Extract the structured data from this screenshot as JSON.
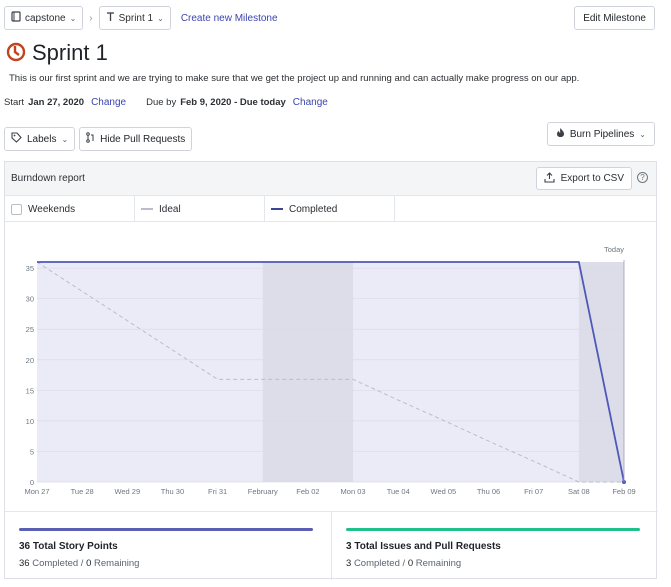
{
  "breadcrumb": {
    "repo": "capstone",
    "milestone": "Sprint 1",
    "create_link": "Create new Milestone"
  },
  "edit_button": "Edit Milestone",
  "milestone": {
    "title": "Sprint 1",
    "description": "This is our first sprint and we are trying to make sure that we get the project up and running and can actually make progress on our app.",
    "start_label": "Start",
    "start_date": "Jan 27, 2020",
    "start_change": "Change",
    "due_label": "Due by",
    "due_date": "Feb 9, 2020 - Due today",
    "due_change": "Change"
  },
  "filters": {
    "labels_button": "Labels",
    "hide_prs_button": "Hide Pull Requests",
    "burn_button": "Burn Pipelines"
  },
  "report": {
    "title": "Burndown report",
    "export_button": "Export to CSV",
    "help": "?",
    "legend": {
      "weekends": "Weekends",
      "ideal": "Ideal",
      "completed": "Completed"
    }
  },
  "colors": {
    "accent": "#4e58b8",
    "milestone_icon": "#c0451f",
    "ideal_line": "#b9bdcc",
    "completed_line": "#4e58b8",
    "weekend_band": "#dcdde8",
    "area_fill": "#ebebf7",
    "story_bar": "#5b5fb3",
    "issues_bar": "#1fc08a"
  },
  "chart_data": {
    "type": "line",
    "title": "",
    "xlabel": "",
    "ylabel": "",
    "ylim": [
      0,
      36
    ],
    "yticks": [
      0,
      5,
      10,
      15,
      20,
      25,
      30,
      35
    ],
    "categories": [
      "Mon 27",
      "Tue 28",
      "Wed 29",
      "Thu 30",
      "Fri 31",
      "February",
      "Feb 02",
      "Mon 03",
      "Tue 04",
      "Wed 05",
      "Thu 06",
      "Fri 07",
      "Sat 08",
      "Feb 09"
    ],
    "weekend_ranges": [
      [
        "February",
        "Mon 03"
      ],
      [
        "Sat 08",
        "Feb 09"
      ]
    ],
    "today_label": "Today",
    "today_index": 13,
    "grid": true,
    "series": [
      {
        "name": "Ideal",
        "style": "dashed",
        "values": [
          36,
          31.2,
          26.4,
          21.6,
          16.8,
          16.8,
          16.8,
          16.8,
          13.4,
          10.1,
          6.7,
          3.4,
          0,
          0
        ]
      },
      {
        "name": "Completed",
        "style": "solid",
        "values": [
          36,
          36,
          36,
          36,
          36,
          36,
          36,
          36,
          36,
          36,
          36,
          36,
          36,
          0
        ]
      }
    ]
  },
  "stats": {
    "story_points": {
      "title": "36 Total Story Points",
      "completed": "36",
      "completed_label": "Completed /",
      "remaining": "0",
      "remaining_label": "Remaining"
    },
    "issues": {
      "title": "3 Total Issues and Pull Requests",
      "completed": "3",
      "completed_label": "Completed /",
      "remaining": "0",
      "remaining_label": "Remaining"
    }
  }
}
